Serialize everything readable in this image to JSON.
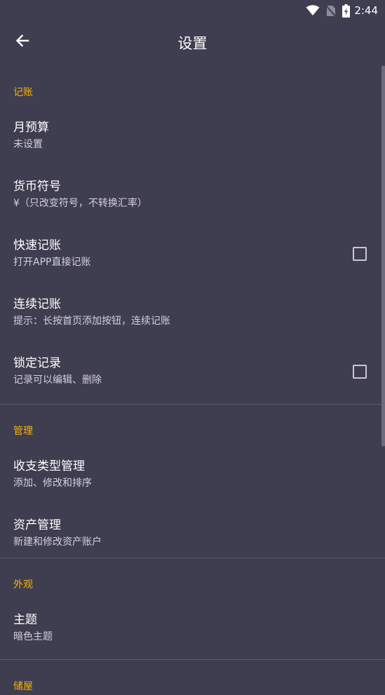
{
  "status_bar": {
    "time": "2:44",
    "icons": [
      "wifi-icon",
      "no-sim-icon",
      "battery-charging-icon"
    ]
  },
  "toolbar": {
    "back_icon": "arrow-left-icon",
    "title": "设置"
  },
  "sections": {
    "record": {
      "header": "记账",
      "monthly_budget": {
        "title": "月预算",
        "summary": "未设置"
      },
      "currency": {
        "title": "货币符号",
        "summary": "¥（只改变符号，不转换汇率）"
      },
      "quick_record": {
        "title": "快速记账",
        "summary": "打开APP直接记账",
        "checked": false
      },
      "continuous_record": {
        "title": "连续记账",
        "summary": "提示：长按首页添加按钮，连续记账"
      },
      "lock_record": {
        "title": "锁定记录",
        "summary": "记录可以编辑、删除",
        "checked": false
      }
    },
    "manage": {
      "header": "管理",
      "category_manage": {
        "title": "收支类型管理",
        "summary": "添加、修改和排序"
      },
      "asset_manage": {
        "title": "资产管理",
        "summary": "新建和修改资产账户"
      }
    },
    "appearance": {
      "header": "外观",
      "theme": {
        "title": "主题",
        "summary": "暗色主题"
      }
    },
    "backup": {
      "header": "储屋"
    }
  },
  "colors": {
    "background": "#3f3d50",
    "accent": "#f5b400",
    "summary_text": "#d2d1dc",
    "divider": "#5b596c"
  }
}
